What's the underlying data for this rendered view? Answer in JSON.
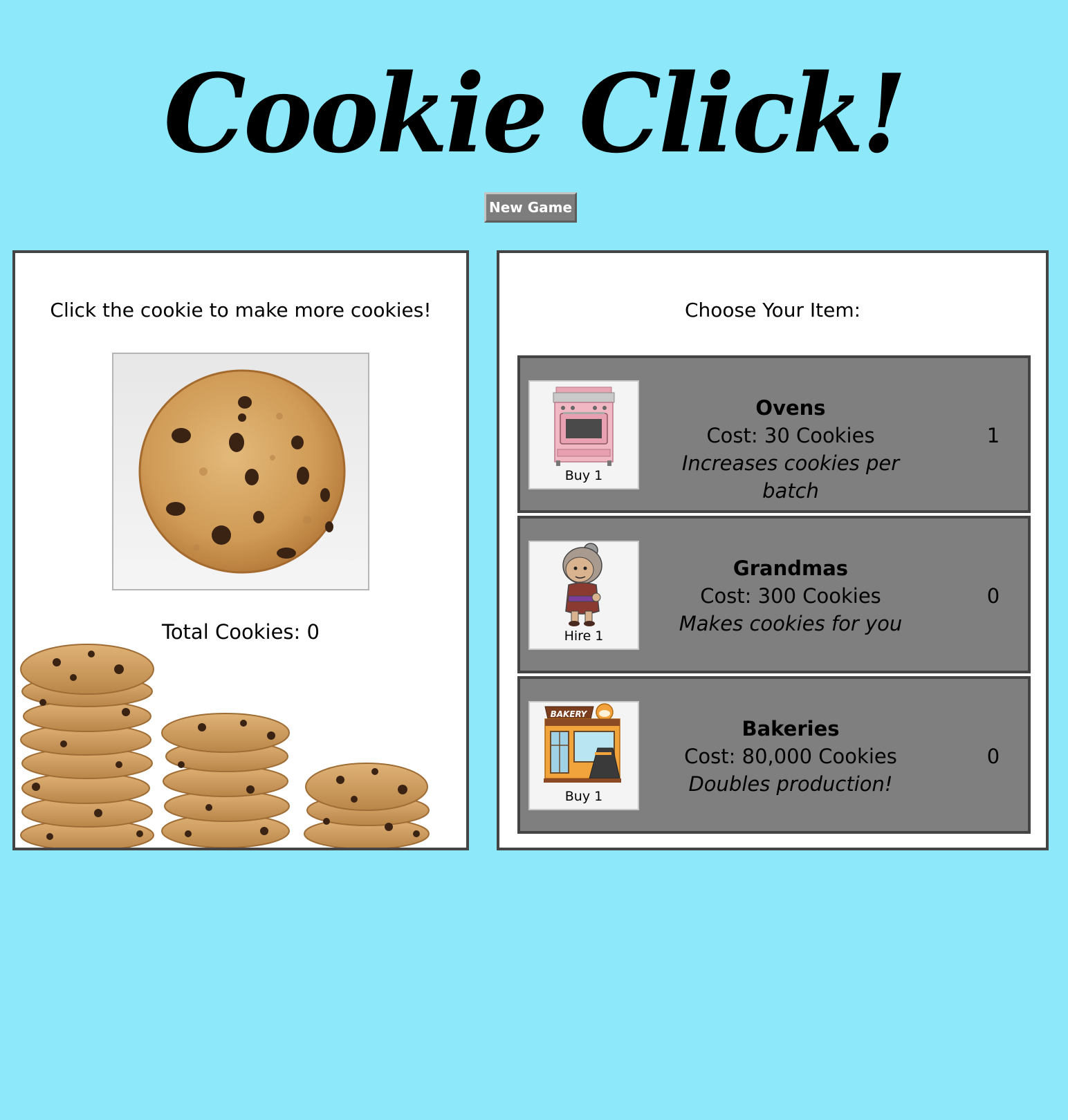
{
  "header": {
    "title": "Cookie Click!",
    "new_game_label": "New Game"
  },
  "clicker": {
    "instruction": "Click the cookie to make more cookies!",
    "total_label": "Total Cookies: 0"
  },
  "store": {
    "heading": "Choose Your Item:",
    "items": [
      {
        "name": "Ovens",
        "cost": "Cost: 30 Cookies",
        "description": "Increases cookies per batch",
        "action": "Buy 1",
        "count": "1",
        "icon": "oven-icon"
      },
      {
        "name": "Grandmas",
        "cost": "Cost: 300 Cookies",
        "description": "Makes cookies for you",
        "action": "Hire 1",
        "count": "0",
        "icon": "grandma-icon"
      },
      {
        "name": "Bakeries",
        "cost": "Cost: 80,000 Cookies",
        "description": "Doubles production!",
        "action": "Buy 1",
        "count": "0",
        "icon": "bakery-icon",
        "sign_text": "BAKERY"
      }
    ]
  },
  "colors": {
    "background": "#8de9fa",
    "panel_border": "#444444",
    "item_background": "#7f7f7f",
    "button_background": "#7d7d7d"
  }
}
